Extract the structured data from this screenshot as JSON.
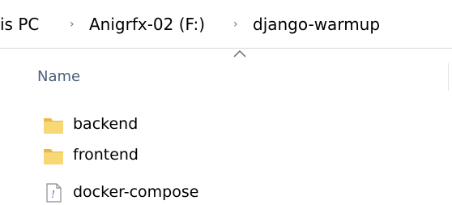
{
  "breadcrumb": {
    "items": [
      {
        "label": "is PC"
      },
      {
        "label": "Anigrfx-02 (F:)"
      },
      {
        "label": "django-warmup"
      }
    ]
  },
  "file_list": {
    "column_header": "Name",
    "sort_direction": "ascending",
    "items": [
      {
        "name": "backend",
        "icon": "folder-icon"
      },
      {
        "name": "frontend",
        "icon": "folder-icon"
      },
      {
        "name": "docker-compose",
        "icon": "yaml-file-icon"
      }
    ]
  },
  "colors": {
    "folder": "#f8d775",
    "folder_dark": "#e8b84a",
    "header_text": "#4c607a"
  }
}
